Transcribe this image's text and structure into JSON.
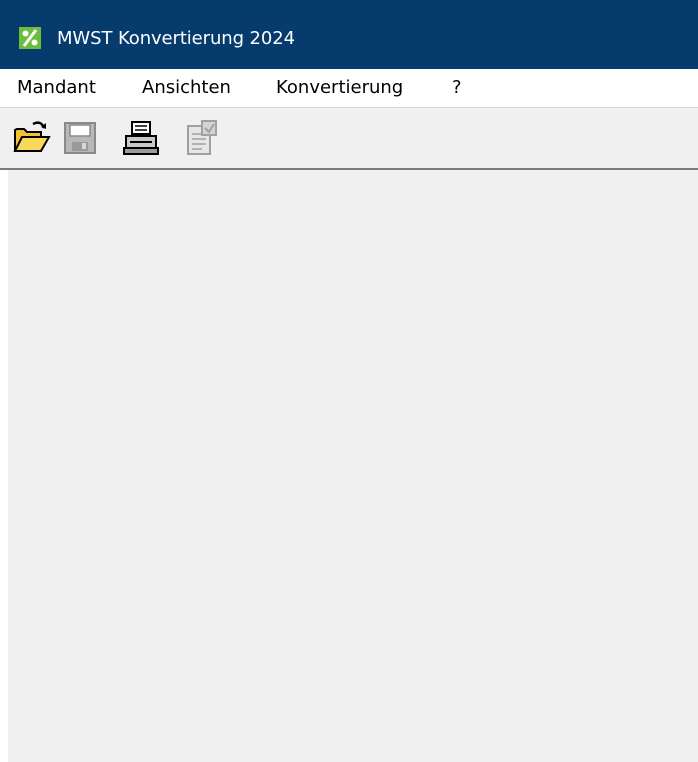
{
  "window": {
    "title": "MWST Konvertierung 2024",
    "icon": "percent-app-icon",
    "titlebar_color": "#053c6d",
    "icon_color": "#6cbd3c"
  },
  "menubar": {
    "items": [
      {
        "label": "Mandant"
      },
      {
        "label": "Ansichten"
      },
      {
        "label": "Konvertierung"
      },
      {
        "label": "?"
      }
    ]
  },
  "toolbar": {
    "buttons": [
      {
        "icon": "open-folder-icon",
        "enabled": true
      },
      {
        "icon": "save-disk-icon",
        "enabled": false
      },
      {
        "icon": "printer-icon",
        "enabled": true
      },
      {
        "icon": "properties-icon",
        "enabled": false
      }
    ]
  }
}
